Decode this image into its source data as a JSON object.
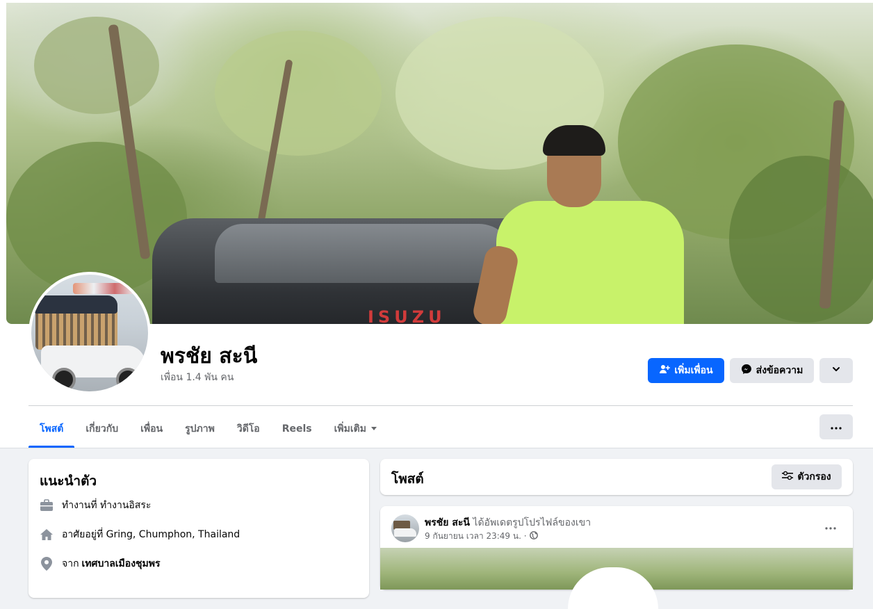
{
  "profile": {
    "name": "พรชัย สะนี",
    "friends_count": "เพื่อน 1.4 พัน คน"
  },
  "cover": {
    "car_badge": "ISUZU"
  },
  "actions": {
    "add_friend": "เพิ่มเพื่อน",
    "message": "ส่งข้อความ",
    "more_icon": "chevron-down-icon"
  },
  "tabs": [
    {
      "label": "โพสต์",
      "active": true
    },
    {
      "label": "เกี่ยวกับ"
    },
    {
      "label": "เพื่อน"
    },
    {
      "label": "รูปภาพ"
    },
    {
      "label": "วิดีโอ"
    },
    {
      "label": "Reels"
    },
    {
      "label": "เพิ่มเติม"
    }
  ],
  "intro": {
    "title": "แนะนำตัว",
    "items": [
      {
        "icon": "briefcase-icon",
        "text": "ทำงานที่ ทำงานอิสระ"
      },
      {
        "icon": "home-icon",
        "text": "อาศัยอยู่ที่ Gring, Chumphon, Thailand"
      },
      {
        "icon": "location-pin-icon",
        "prefix": "จาก",
        "bold": "เทศบาลเมืองชุมพร"
      }
    ]
  },
  "posts_section": {
    "title": "โพสต์",
    "filter_label": "ตัวกรอง"
  },
  "post": {
    "author": "พรชัย สะนี",
    "action": "ได้อัพเดตรูปโปรไฟล์ของเขา",
    "time": "9 กันยายน เวลา 23:49 น. ·"
  },
  "colors": {
    "primary": "#0866ff",
    "secondary_button": "#e4e6eb",
    "background": "#f0f2f5"
  }
}
